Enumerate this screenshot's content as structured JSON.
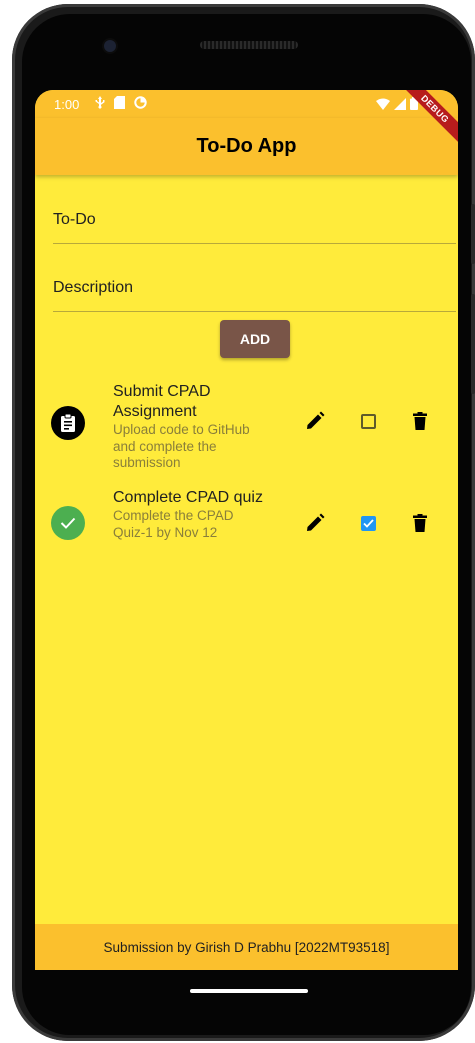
{
  "status_bar": {
    "time": "1:00"
  },
  "app_bar": {
    "title": "To-Do App",
    "debug_label": "DEBUG"
  },
  "form": {
    "todo_placeholder": "To-Do",
    "description_placeholder": "Description",
    "add_label": "ADD"
  },
  "todos": [
    {
      "title": "Submit CPAD Assignment",
      "description": "Upload code to GitHub and complete the submission",
      "completed": false,
      "avatar_icon": "clipboard-icon"
    },
    {
      "title": "Complete CPAD quiz",
      "description": "Complete the CPAD Quiz-1 by Nov 12",
      "completed": true,
      "avatar_icon": "check-icon"
    }
  ],
  "footer": {
    "text": "Submission by Girish D Prabhu [2022MT93518]"
  },
  "colors": {
    "background": "#ffeb3b",
    "app_bar": "#fbc02d",
    "add_button": "#795548",
    "checkbox_checked": "#2196f3",
    "done_avatar": "#4caf50",
    "debug_ribbon": "#b71c1c"
  }
}
